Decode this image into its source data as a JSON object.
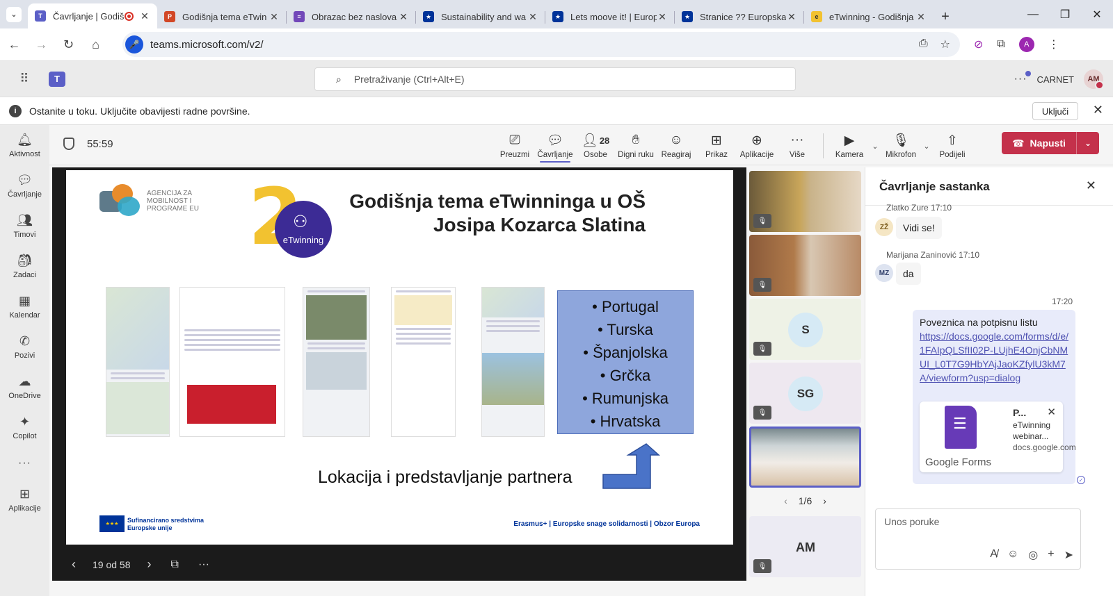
{
  "browser": {
    "tabs": [
      {
        "title": "Čavrljanje | Godiš",
        "favicon_color": "#5b5fc7",
        "active": true,
        "recording": true
      },
      {
        "title": "Godišnja tema eTwin",
        "favicon_color": "#d24726"
      },
      {
        "title": "Obrazac bez naslova",
        "favicon_color": "#7248b9"
      },
      {
        "title": "Sustainability and wa",
        "favicon_color": "#003399"
      },
      {
        "title": "Lets moove it! | Europ",
        "favicon_color": "#003399"
      },
      {
        "title": "Stranice ?? Europska",
        "favicon_color": "#003399"
      },
      {
        "title": "eTwinning - Godišnja",
        "favicon_color": "#f2c230"
      }
    ],
    "url": "teams.microsoft.com/v2/"
  },
  "teams": {
    "search_placeholder": "Pretraživanje (Ctrl+Alt+E)",
    "org": "CARNET",
    "user_initials": "AM"
  },
  "banner": {
    "message": "Ostanite u toku. Uključite obavijesti radne površine.",
    "button": "Uključi"
  },
  "rail": [
    {
      "label": "Aktivnost",
      "icon": "bell-icon"
    },
    {
      "label": "Čavrljanje",
      "icon": "chat-icon"
    },
    {
      "label": "Timovi",
      "icon": "teams-icon"
    },
    {
      "label": "Zadaci",
      "icon": "backpack-icon"
    },
    {
      "label": "Kalendar",
      "icon": "calendar-icon"
    },
    {
      "label": "Pozivi",
      "icon": "phone-icon"
    },
    {
      "label": "OneDrive",
      "icon": "cloud-icon"
    },
    {
      "label": "Copilot",
      "icon": "copilot-icon"
    }
  ],
  "rail_apps": "Aplikacije",
  "meeting": {
    "timer": "55:59",
    "tools": {
      "preuzmi": "Preuzmi",
      "chat": "Čavrljanje",
      "people": "Osobe",
      "people_count": "28",
      "raise": "Digni ruku",
      "react": "Reagiraj",
      "view": "Prikaz",
      "apps": "Aplikacije",
      "more": "Više",
      "camera": "Kamera",
      "mic": "Mikrofon",
      "share": "Podijeli"
    },
    "leave": "Napusti"
  },
  "slide": {
    "agency": "Agencija za mobilnost i programe EU",
    "title_line1": "Godišnja tema eTwinninga u OŠ",
    "title_line2": "Josipa Kozarca Slatina",
    "etwinning_label": "eTwinning",
    "countries": [
      "Portugal",
      "Turska",
      "Španjolska",
      "Grčka",
      "Rumunjska",
      "Hrvatska"
    ],
    "caption": "Lokacija i predstavljanje partnera",
    "eu_line1": "Sufinancirano sredstvima",
    "eu_line2": "Europske unije",
    "programs": "Erasmus+  |  Europske snage solidarnosti  |  Obzor Europa",
    "counter": "19 od 58"
  },
  "participants": [
    {
      "type": "video"
    },
    {
      "type": "video"
    },
    {
      "type": "initials",
      "initials": "S"
    },
    {
      "type": "initials",
      "initials": "SG"
    },
    {
      "type": "video",
      "speaking": true
    }
  ],
  "participants_pager": "1/6",
  "self_tile": {
    "initials": "AM"
  },
  "chat": {
    "title": "Čavrljanje sastanka",
    "messages": [
      {
        "author": "Zlatko Zure",
        "time": "17:10",
        "initials": "ZŽ",
        "text": "Vidi se!"
      },
      {
        "author": "Marijana Zaninović",
        "time": "17:10",
        "initials": "MZ",
        "text": "da"
      }
    ],
    "my_time": "17:20",
    "my_text": "Poveznica na potpisnu listu",
    "my_link": "https://docs.google.com/forms/d/e/1FAIpQLSfII02P-LUjhE4OnjCbNMUI_L0T7G9HbYAjJaoKZfylU3kM7A/viewform?usp=dialog",
    "card": {
      "title": "P...",
      "desc": "eTwinning webinar...",
      "domain": "docs.google.com",
      "brand": "Google Forms"
    },
    "compose_placeholder": "Unos poruke"
  }
}
